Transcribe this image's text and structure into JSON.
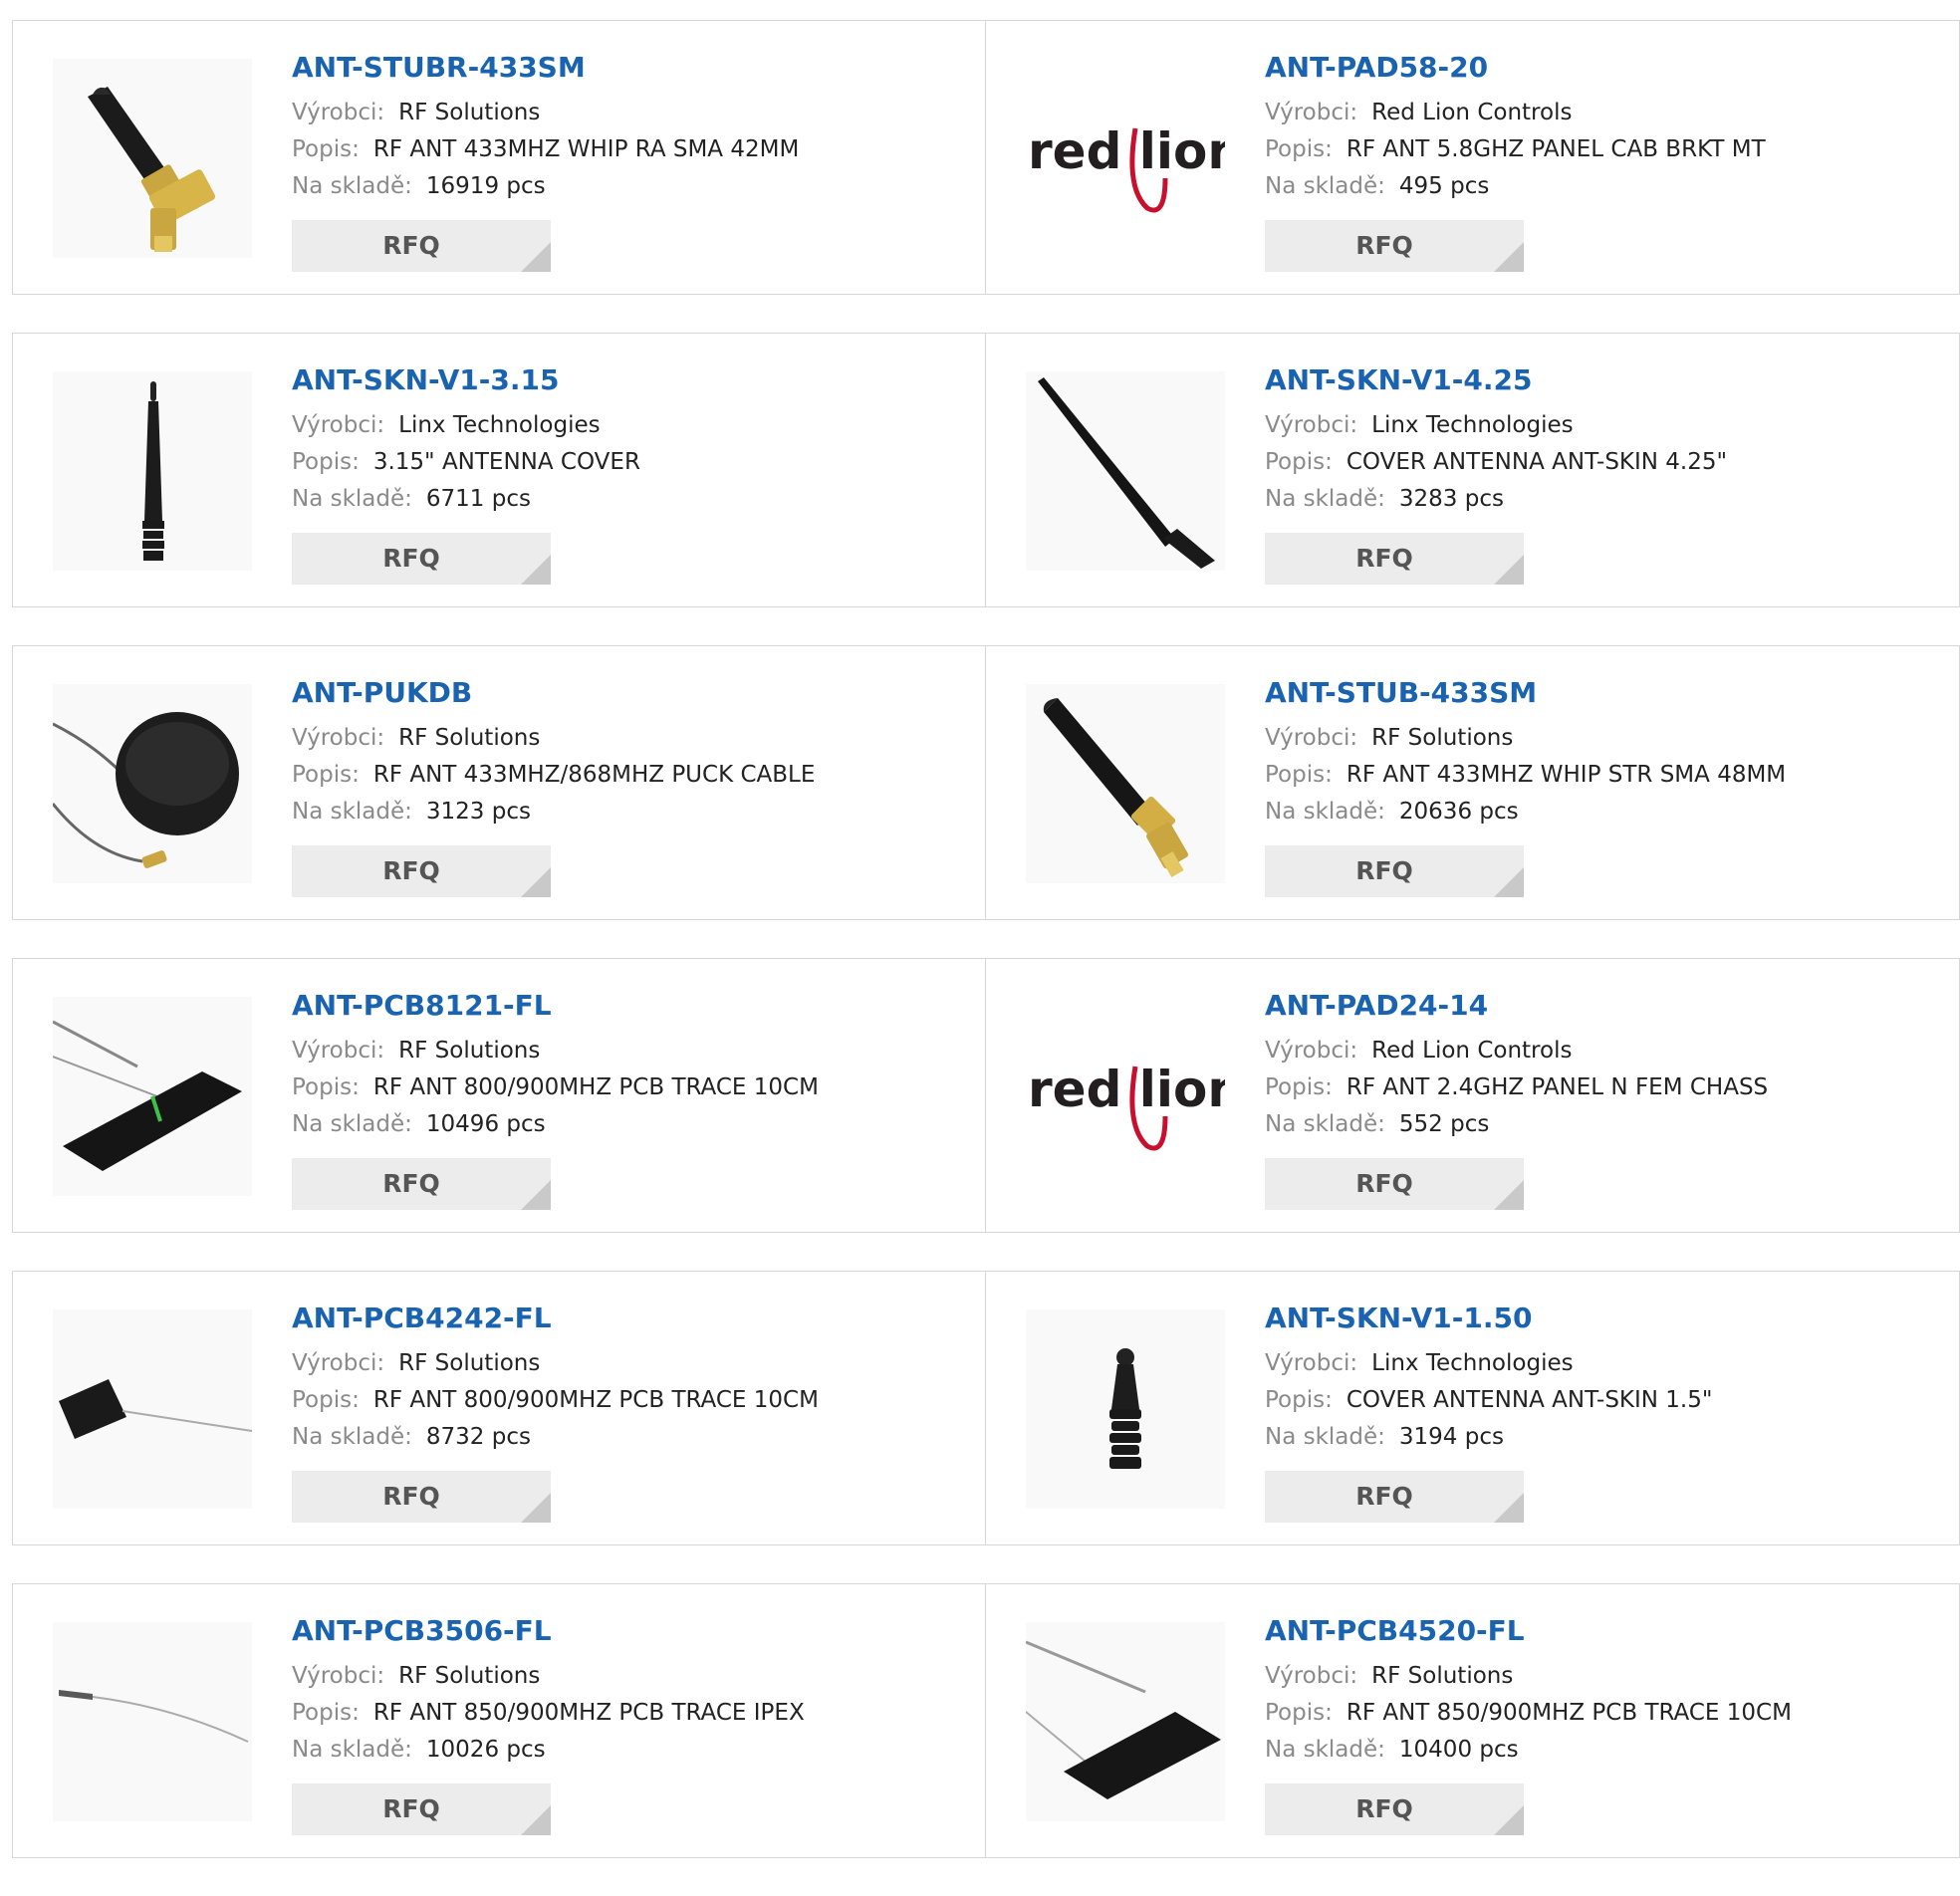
{
  "labels": {
    "manufacturer": "Výrobci:",
    "description": "Popis:",
    "stock": "Na skladě:",
    "rfq": "RFQ"
  },
  "products": [
    {
      "pn": "ANT-STUBR-433SM",
      "manufacturer": "RF Solutions",
      "description": "RF ANT 433MHZ WHIP RA SMA 42MM",
      "stock": "16919 pcs",
      "image": "right-angle-stub-antenna"
    },
    {
      "pn": "ANT-PAD58-20",
      "manufacturer": "Red Lion Controls",
      "description": "RF ANT 5.8GHZ PANEL CAB BRKT MT",
      "stock": "495 pcs",
      "image": "red-lion-logo",
      "logo_text": "red lion"
    },
    {
      "pn": "ANT-SKN-V1-3.15",
      "manufacturer": "Linx Technologies",
      "description": "3.15\" ANTENNA COVER",
      "stock": "6711 pcs",
      "image": "vertical-antenna-cover"
    },
    {
      "pn": "ANT-SKN-V1-4.25",
      "manufacturer": "Linx Technologies",
      "description": "COVER ANTENNA ANT-SKIN 4.25\"",
      "stock": "3283 pcs",
      "image": "diagonal-antenna-cover"
    },
    {
      "pn": "ANT-PUKDB",
      "manufacturer": "RF Solutions",
      "description": "RF ANT 433MHZ/868MHZ PUCK CABLE",
      "stock": "3123 pcs",
      "image": "puck-antenna"
    },
    {
      "pn": "ANT-STUB-433SM",
      "manufacturer": "RF Solutions",
      "description": "RF ANT 433MHZ WHIP STR SMA 48MM",
      "stock": "20636 pcs",
      "image": "straight-stub-antenna"
    },
    {
      "pn": "ANT-PCB8121-FL",
      "manufacturer": "RF Solutions",
      "description": "RF ANT 800/900MHZ PCB TRACE 10CM",
      "stock": "10496 pcs",
      "image": "pcb-strip-antenna"
    },
    {
      "pn": "ANT-PAD24-14",
      "manufacturer": "Red Lion Controls",
      "description": "RF ANT 2.4GHZ PANEL N FEM CHASS",
      "stock": "552 pcs",
      "image": "red-lion-logo",
      "logo_text": "red lion"
    },
    {
      "pn": "ANT-PCB4242-FL",
      "manufacturer": "RF Solutions",
      "description": "RF ANT 800/900MHZ PCB TRACE 10CM",
      "stock": "8732 pcs",
      "image": "small-pcb-antenna"
    },
    {
      "pn": "ANT-SKN-V1-1.50",
      "manufacturer": "Linx Technologies",
      "description": "COVER ANTENNA ANT-SKIN 1.5\"",
      "stock": "3194 pcs",
      "image": "short-antenna-cover"
    },
    {
      "pn": "ANT-PCB3506-FL",
      "manufacturer": "RF Solutions",
      "description": "RF ANT 850/900MHZ PCB TRACE IPEX",
      "stock": "10026 pcs",
      "image": "thin-pcb-antenna"
    },
    {
      "pn": "ANT-PCB4520-FL",
      "manufacturer": "RF Solutions",
      "description": "RF ANT 850/900MHZ PCB TRACE 10CM",
      "stock": "10400 pcs",
      "image": "wide-pcb-antenna"
    }
  ]
}
